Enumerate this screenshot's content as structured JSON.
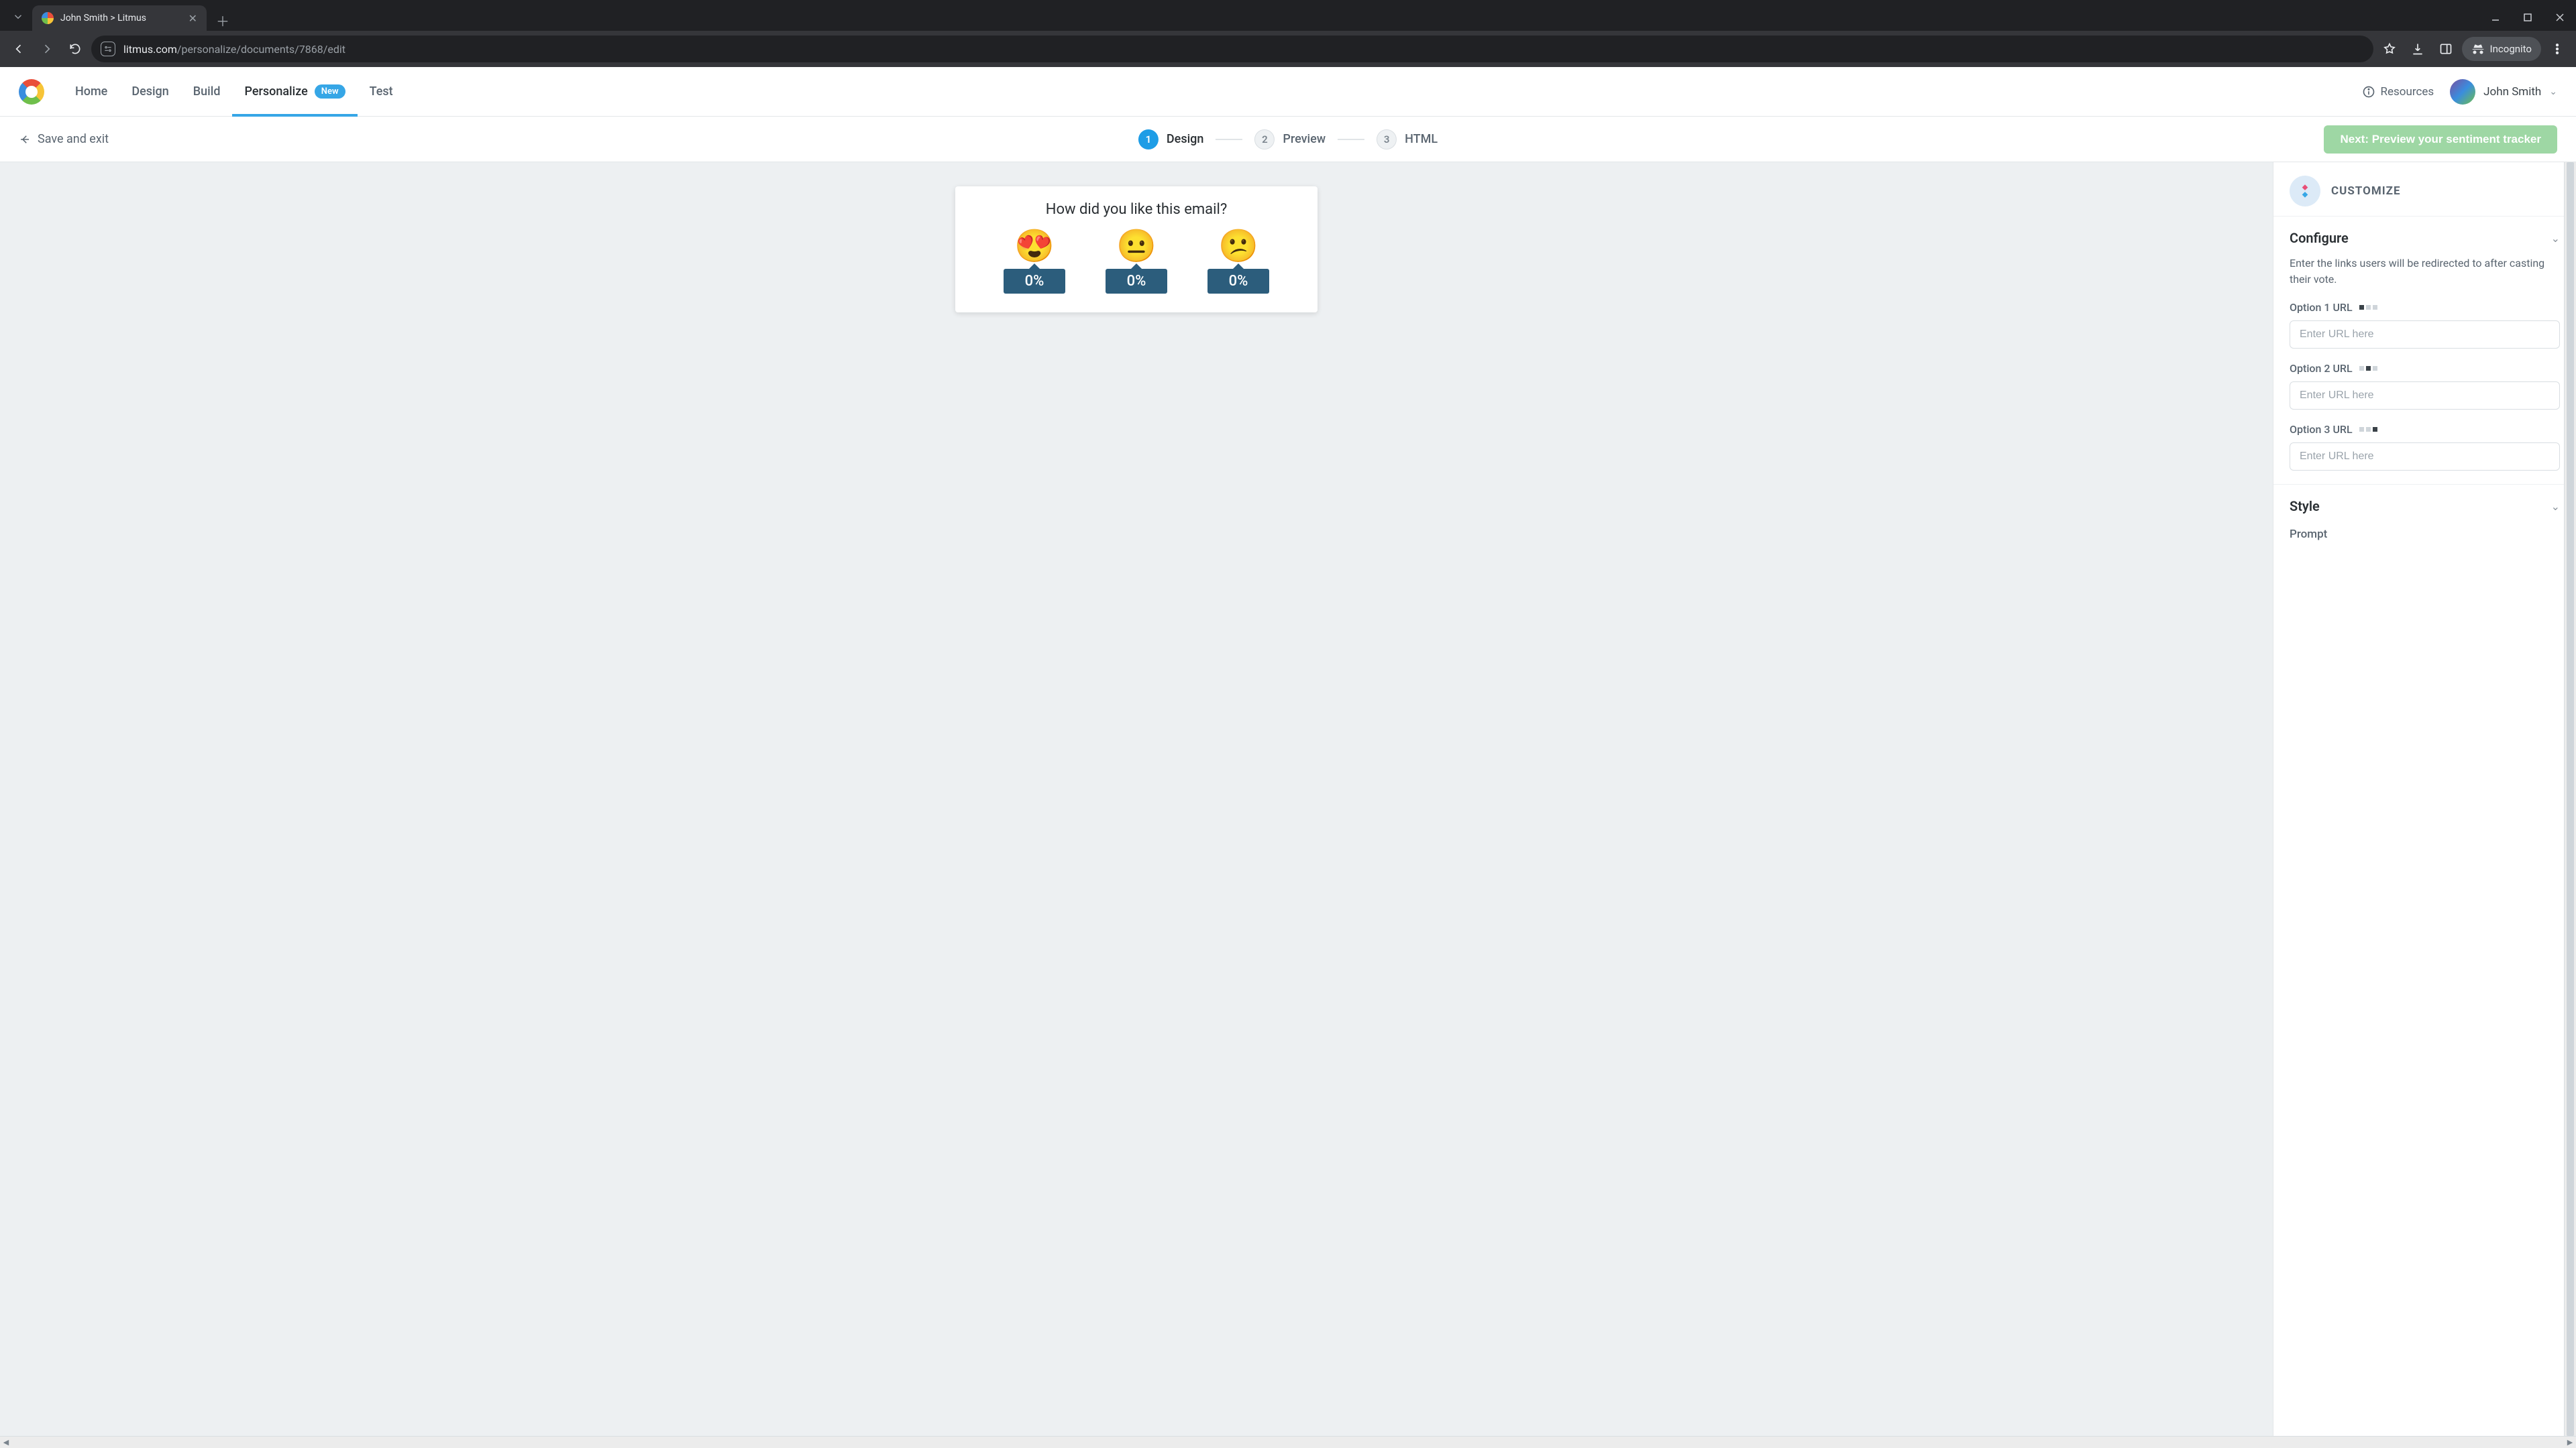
{
  "browser": {
    "tab_title": "John Smith > Litmus",
    "url_host": "litmus.com",
    "url_path": "/personalize/documents/7868/edit",
    "incognito_label": "Incognito"
  },
  "header": {
    "nav": {
      "home": "Home",
      "design": "Design",
      "build": "Build",
      "personalize": "Personalize",
      "personalize_badge": "New",
      "test": "Test"
    },
    "resources": "Resources",
    "user_name": "John Smith"
  },
  "subheader": {
    "save_exit": "Save and exit",
    "steps": {
      "s1_num": "1",
      "s1_label": "Design",
      "s2_num": "2",
      "s2_label": "Preview",
      "s3_num": "3",
      "s3_label": "HTML"
    },
    "next_button": "Next: Preview your sentiment tracker"
  },
  "preview": {
    "prompt": "How did you like this email?",
    "options": [
      {
        "emoji": "😍",
        "pct": "0%"
      },
      {
        "emoji": "😐",
        "pct": "0%"
      },
      {
        "emoji": "😕",
        "pct": "0%"
      }
    ]
  },
  "panel": {
    "title": "CUSTOMIZE",
    "configure": {
      "title": "Configure",
      "desc": "Enter the links users will be redirected to after casting their vote.",
      "opt1_label": "Option 1 URL",
      "opt2_label": "Option 2 URL",
      "opt3_label": "Option 3 URL",
      "placeholder": "Enter URL here"
    },
    "style": {
      "title": "Style"
    },
    "prompt_section": {
      "title": "Prompt"
    }
  }
}
